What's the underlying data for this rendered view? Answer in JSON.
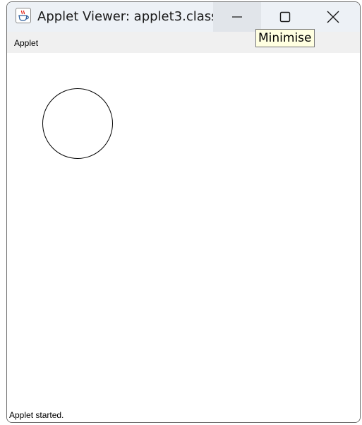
{
  "window": {
    "title": "Applet Viewer: applet3.class",
    "app_icon": "java-icon",
    "caption_buttons": {
      "minimize_icon": "minimize-icon",
      "maximize_icon": "maximize-icon",
      "close_icon": "close-icon"
    }
  },
  "menubar": {
    "items": [
      {
        "label": "Applet"
      }
    ]
  },
  "canvas": {
    "shapes": [
      {
        "type": "circle",
        "stroke": "#000000",
        "fill": "none"
      }
    ]
  },
  "status": {
    "text": "Applet started."
  },
  "tooltip": {
    "text": "Minimise"
  },
  "colors": {
    "titlebar": "#edf1f6",
    "hovered_button": "#e1e5ea",
    "menubar": "#f0f0f0",
    "tooltip_bg": "#ffffe1"
  }
}
